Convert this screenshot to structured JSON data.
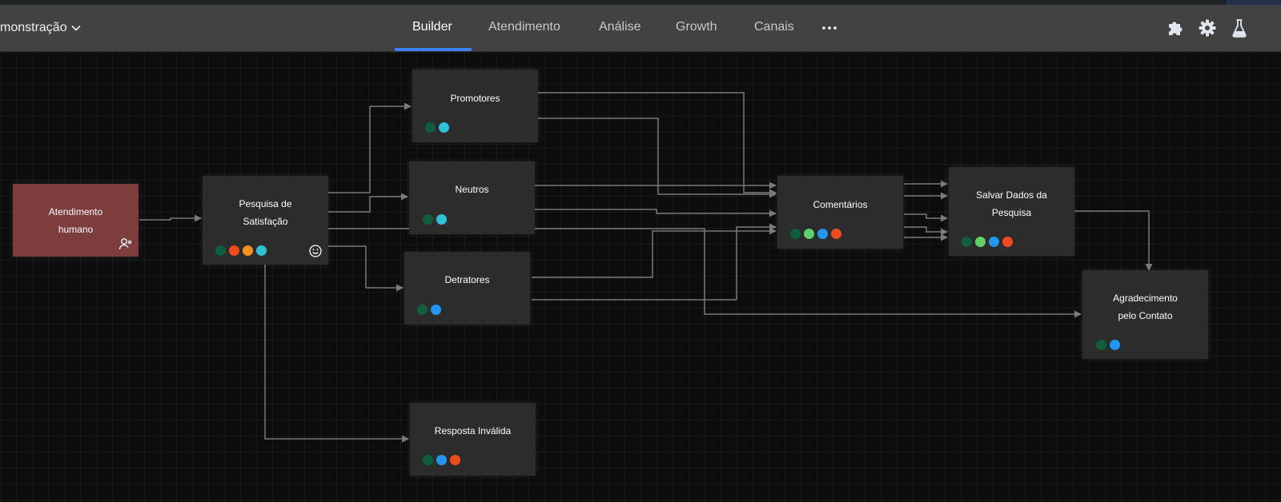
{
  "header": {
    "bot_name": "monstração",
    "tabs": [
      {
        "label": "Builder",
        "active": true
      },
      {
        "label": "Atendimento",
        "active": false
      },
      {
        "label": "Análise",
        "active": false
      },
      {
        "label": "Growth",
        "active": false
      },
      {
        "label": "Canais",
        "active": false
      }
    ],
    "more_icon": "ellipsis-icon",
    "tools": [
      "extensions-puzzle-icon",
      "settings-gear-icon",
      "lab-flask-icon"
    ]
  },
  "colors": {
    "accent": "#3d7ff2",
    "node_bg": "#2c2c2c",
    "node_human": "#7e3d3d",
    "dot_dark_green": "#0e5f3e",
    "dot_red": "#f24b1d",
    "dot_orange": "#f5931e",
    "dot_cyan": "#2cc3d6",
    "dot_light_green": "#5fd068",
    "dot_blue": "#2196f3"
  },
  "nodes": {
    "atendimento": {
      "title": "Atendimento humano",
      "dots": [],
      "icon": "human-agent-icon"
    },
    "pesquisa": {
      "title": "Pesquisa de Satisfação",
      "dots": [
        "#0e5f3e",
        "#f24b1d",
        "#f5931e",
        "#2cc3d6"
      ],
      "icon": "smiley-icon"
    },
    "promotores": {
      "title": "Promotores",
      "dots": [
        "#0e5f3e",
        "#2cc3d6"
      ]
    },
    "neutros": {
      "title": "Neutros",
      "dots": [
        "#0e5f3e",
        "#2cc3d6"
      ]
    },
    "detratores": {
      "title": "Detratores",
      "dots": [
        "#0e5f3e",
        "#2196f3"
      ]
    },
    "resposta": {
      "title": "Resposta Inválida",
      "dots": [
        "#0e5f3e",
        "#2196f3",
        "#f24b1d"
      ]
    },
    "comentarios": {
      "title": "Comentários",
      "dots": [
        "#0e5f3e",
        "#5fd068",
        "#2196f3",
        "#f24b1d"
      ]
    },
    "salvar": {
      "title": "Salvar Dados da Pesquisa",
      "dots": [
        "#0e5f3e",
        "#5fd068",
        "#2196f3",
        "#f24b1d"
      ]
    },
    "agradecimento": {
      "title": "Agradecimento pelo Contato",
      "dots": [
        "#0e5f3e",
        "#2196f3"
      ]
    }
  }
}
